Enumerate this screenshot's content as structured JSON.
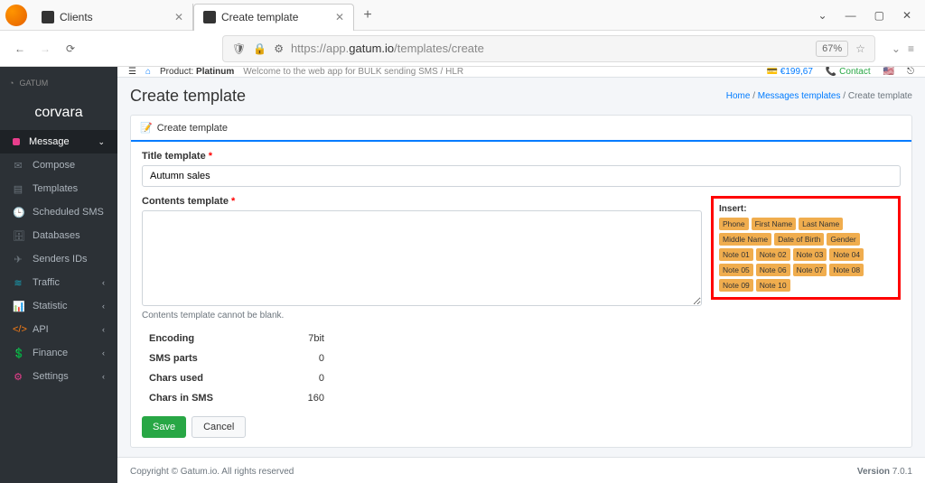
{
  "browser": {
    "tabs": [
      {
        "title": "Clients"
      },
      {
        "title": "Create template"
      }
    ],
    "url_prefix": "https://app.",
    "url_domain": "gatum.io",
    "url_path": "/templates/create",
    "zoom": "67%"
  },
  "sidebar": {
    "brand": "corvara",
    "logo_sub": "GATUM",
    "items": [
      {
        "label": "Message",
        "expandable": true,
        "active": true
      },
      {
        "label": "Compose"
      },
      {
        "label": "Templates"
      },
      {
        "label": "Scheduled SMS"
      },
      {
        "label": "Databases"
      },
      {
        "label": "Senders IDs"
      },
      {
        "label": "Traffic",
        "expandable": true,
        "cls": "traffic"
      },
      {
        "label": "Statistic",
        "expandable": true,
        "cls": "stat"
      },
      {
        "label": "API",
        "expandable": true,
        "cls": "api"
      },
      {
        "label": "Finance",
        "expandable": true,
        "cls": "fin"
      },
      {
        "label": "Settings",
        "expandable": true,
        "cls": "set"
      }
    ]
  },
  "topbar": {
    "product_label": "Product:",
    "product": "Platinum",
    "welcome": "Welcome to the web app for BULK sending SMS / HLR",
    "balance": "€199,67",
    "contact": "Contact"
  },
  "page": {
    "title": "Create template",
    "breadcrumb": {
      "home": "Home",
      "mid": "Messages templates",
      "current": "Create template"
    },
    "card_title": "Create template",
    "title_label": "Title template",
    "title_value": "Autumn sales",
    "content_label": "Contents template",
    "help": "Contents template cannot be blank.",
    "insert_label": "Insert:",
    "chips": [
      "Phone",
      "First Name",
      "Last Name",
      "Middle Name",
      "Date of Birth",
      "Gender",
      "Note 01",
      "Note 02",
      "Note 03",
      "Note 04",
      "Note 05",
      "Note 06",
      "Note 07",
      "Note 08",
      "Note 09",
      "Note 10"
    ],
    "stats": {
      "encoding_l": "Encoding",
      "encoding_v": "7bit",
      "parts_l": "SMS parts",
      "parts_v": "0",
      "chars_l": "Chars used",
      "chars_v": "0",
      "chars_sms_l": "Chars in SMS",
      "chars_sms_v": "160"
    },
    "save": "Save",
    "cancel": "Cancel"
  },
  "footer": {
    "copyright": "Copyright © Gatum.io. All rights reserved",
    "version_l": "Version",
    "version": "7.0.1"
  }
}
